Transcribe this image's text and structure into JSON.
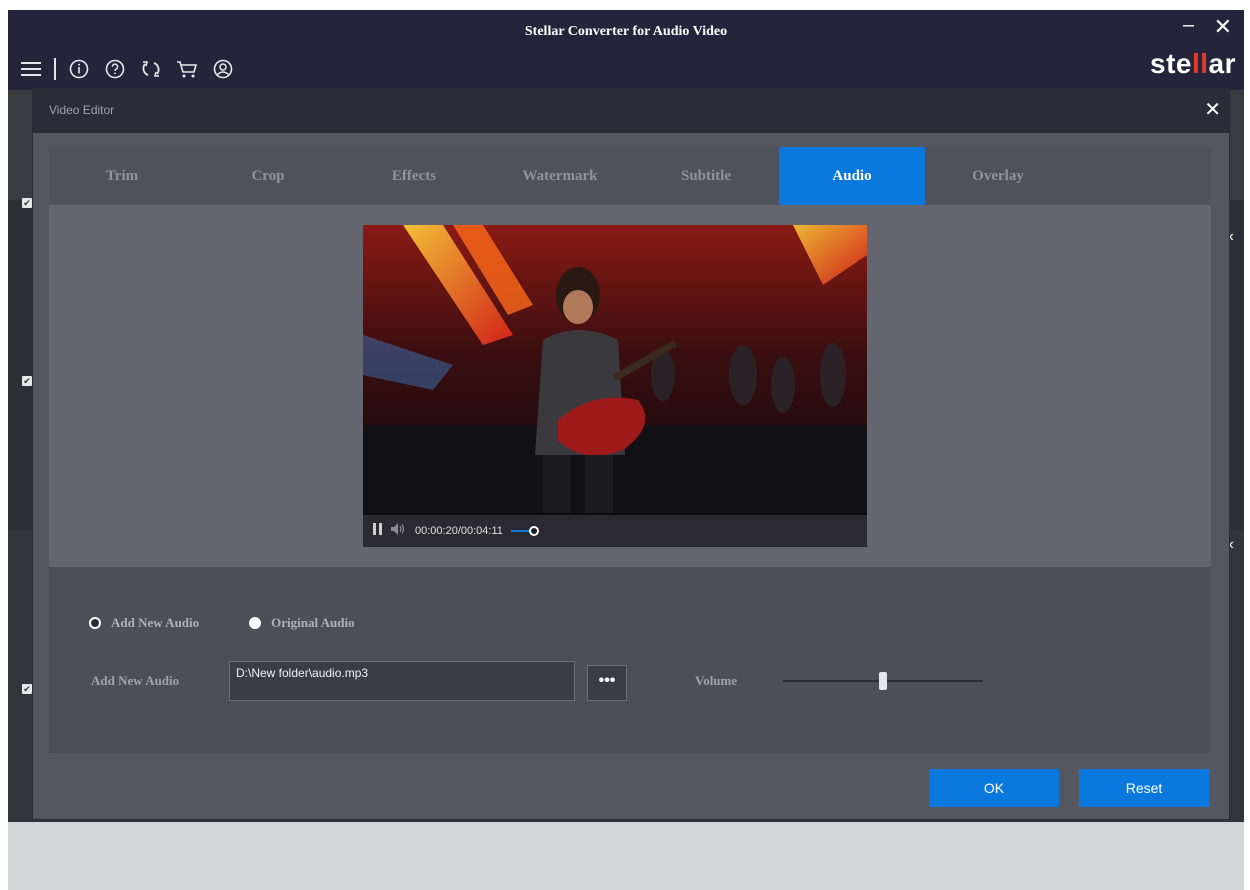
{
  "window": {
    "title": "Stellar Converter for Audio Video",
    "minimize": "–",
    "close": "✕"
  },
  "brand": {
    "logo_left": "ste",
    "logo_mid": "ll",
    "logo_right": "ar"
  },
  "toolbar": {
    "icons": [
      "menu-icon",
      "info-icon",
      "help-icon",
      "refresh-icon",
      "cart-icon",
      "account-icon"
    ]
  },
  "dialog": {
    "title": "Video Editor",
    "close": "✕",
    "tabs": [
      {
        "label": "Trim",
        "active": false
      },
      {
        "label": "Crop",
        "active": false
      },
      {
        "label": "Effects",
        "active": false
      },
      {
        "label": "Watermark",
        "active": false
      },
      {
        "label": "Subtitle",
        "active": false
      },
      {
        "label": "Audio",
        "active": true
      },
      {
        "label": "Overlay",
        "active": false
      }
    ],
    "player": {
      "time": "00:00:20/00:04:11",
      "progress": 0.08
    },
    "audio": {
      "option_new": "Add New Audio",
      "option_original": "Original Audio",
      "selected": "Original Audio",
      "field_label": "Add New Audio",
      "path_value": "D:\\New folder\\audio.mp3",
      "browse_label": "•••",
      "volume_label": "Volume",
      "volume_level": 0.5
    },
    "buttons": {
      "ok": "OK",
      "reset": "Reset"
    }
  },
  "colors": {
    "accent": "#0a78dc",
    "titlebar": "#24243a",
    "panel": "#63656f"
  }
}
